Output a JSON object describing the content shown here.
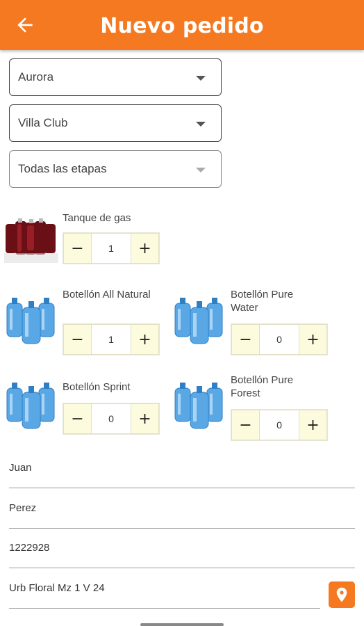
{
  "header": {
    "title": "Nuevo pedido",
    "back_icon": "arrow-left-icon",
    "color": "#f47920"
  },
  "selects": [
    {
      "value": "Aurora",
      "enabled": true
    },
    {
      "value": "Villa Club",
      "enabled": true
    },
    {
      "value": "Todas las etapas",
      "enabled": false
    }
  ],
  "products": [
    {
      "name": "Tanque de gas",
      "quantity": "1",
      "icon": "gas-tank-image"
    },
    {
      "name": "Botellón All Natural",
      "quantity": "1",
      "icon": "water-bottles-image"
    },
    {
      "name": "Botellón Pure Water",
      "quantity": "0",
      "icon": "water-bottles-image"
    },
    {
      "name": "Botellón Sprint",
      "quantity": "0",
      "icon": "water-bottles-image"
    },
    {
      "name": "Botellón Pure Forest",
      "quantity": "0",
      "icon": "water-bottles-image"
    }
  ],
  "stepper": {
    "minus": "−",
    "plus": "+"
  },
  "form": {
    "first_name": "Juan",
    "last_name": "Perez",
    "phone": "1222928",
    "address": "Urb Floral Mz 1 V 24"
  },
  "location_icon": "map-pin-icon"
}
